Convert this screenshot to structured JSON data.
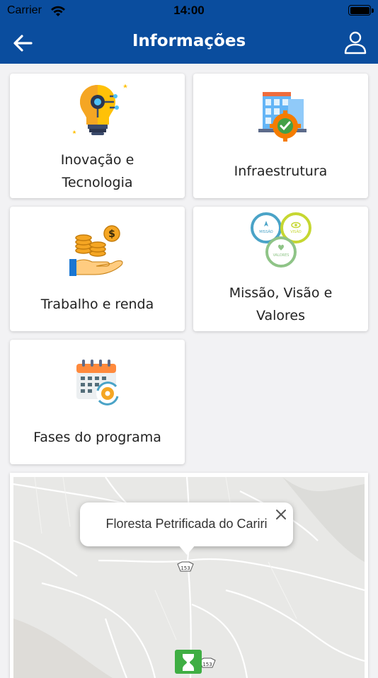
{
  "status_bar": {
    "carrier": "Carrier",
    "time": "14:00"
  },
  "nav": {
    "title": "Informações"
  },
  "cards": [
    {
      "label_line1": "Inovação e",
      "label_line2": "Tecnologia",
      "icon": "lightbulb-gear-icon"
    },
    {
      "label": "Infraestrutura",
      "icon": "building-gear-icon"
    },
    {
      "label": "Trabalho e renda",
      "icon": "hand-coins-icon"
    },
    {
      "label_line1": "Missão, Visão e",
      "label_line2": "Valores",
      "icon": "mission-vision-values-icon",
      "circle_labels": [
        "MISSÃO",
        "VISÃO",
        "VALORES"
      ]
    },
    {
      "label": "Fases do programa",
      "icon": "calendar-gear-icon"
    }
  ],
  "map": {
    "popup_text": "Floresta Petrificada do Cariri",
    "road_labels": [
      "153",
      "153"
    ]
  },
  "colors": {
    "brand": "#0a4d9e",
    "marker": "#3fae43"
  }
}
